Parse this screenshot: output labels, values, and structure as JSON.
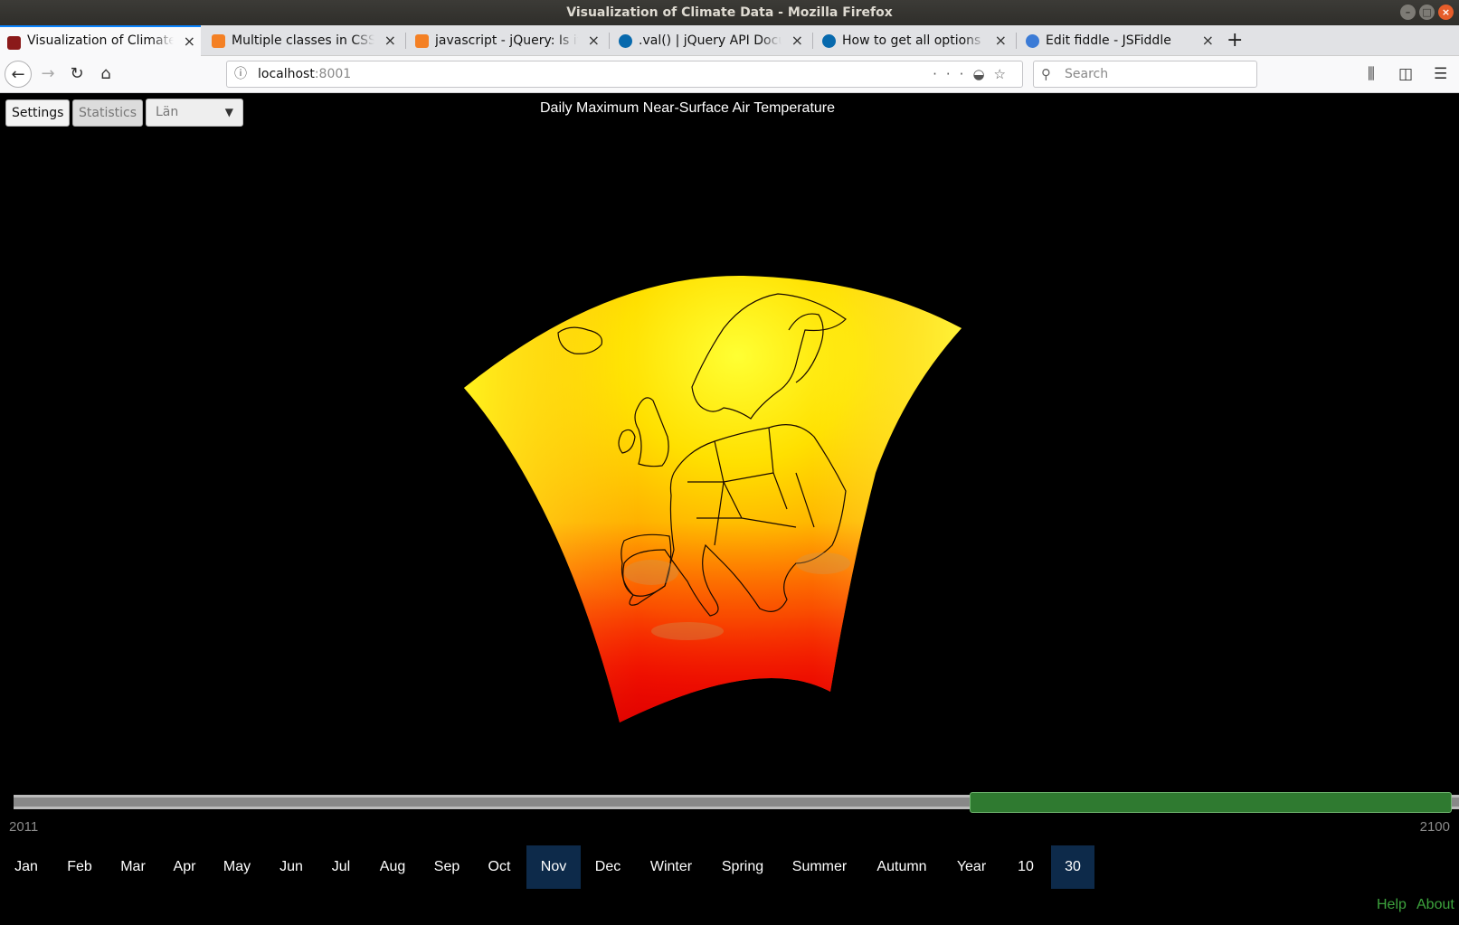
{
  "window": {
    "title": "Visualization of Climate Data - Mozilla Firefox"
  },
  "tabs": [
    {
      "label": "Visualization of Climate Data",
      "favicon_color": "#8b1a1a"
    },
    {
      "label": "Multiple classes in CSS Selector",
      "favicon_color": "#f48024"
    },
    {
      "label": "javascript - jQuery: Is it possible",
      "favicon_color": "#f48024"
    },
    {
      "label": ".val() | jQuery API Documentation",
      "favicon_color": "#0769ad"
    },
    {
      "label": "How to get all options values",
      "favicon_color": "#0769ad"
    },
    {
      "label": "Edit fiddle - JSFiddle",
      "favicon_color": "#3b7bd6"
    }
  ],
  "navbar": {
    "url_host": "localhost",
    "url_port": ":8001",
    "search_placeholder": "Search"
  },
  "app": {
    "settings_label": "Settings",
    "statistics_label": "Statistics",
    "region_select": "Län",
    "map_title": "Daily Maximum Near-Surface Air Temperature",
    "timeline": {
      "start_year": "2011",
      "end_year": "2100",
      "range_start_fraction": 0.665,
      "range_end_fraction": 1.0
    },
    "periods": [
      {
        "label": "Jan",
        "selected": false
      },
      {
        "label": "Feb",
        "selected": false
      },
      {
        "label": "Mar",
        "selected": false
      },
      {
        "label": "Apr",
        "selected": false
      },
      {
        "label": "May",
        "selected": false
      },
      {
        "label": "Jun",
        "selected": false
      },
      {
        "label": "Jul",
        "selected": false
      },
      {
        "label": "Aug",
        "selected": false
      },
      {
        "label": "Sep",
        "selected": false
      },
      {
        "label": "Oct",
        "selected": false
      },
      {
        "label": "Nov",
        "selected": true
      },
      {
        "label": "Dec",
        "selected": false
      },
      {
        "label": "Winter",
        "selected": false
      },
      {
        "label": "Spring",
        "selected": false
      },
      {
        "label": "Summer",
        "selected": false
      },
      {
        "label": "Autumn",
        "selected": false
      },
      {
        "label": "Year",
        "selected": false
      },
      {
        "label": "10",
        "selected": false
      },
      {
        "label": "30",
        "selected": true
      }
    ],
    "help_label": "Help",
    "about_label": "About",
    "colors": {
      "selected_period": "#0d2a4a",
      "range": "#2f7a30",
      "link": "#3da33d",
      "hot": "#ff0000",
      "mild": "#ffff00"
    }
  }
}
